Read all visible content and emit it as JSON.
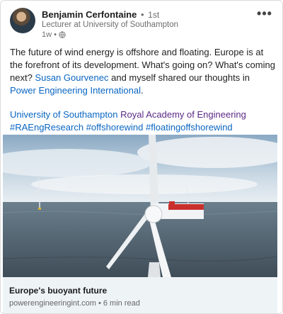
{
  "post": {
    "author": {
      "name": "Benjamin Cerfontaine",
      "separator": "•",
      "degree": "1st",
      "headline": "Lecturer at University of Southampton",
      "time": "1w •"
    },
    "more_label": "•••",
    "body": {
      "p1": "The future of wind energy is offshore and floating. Europe is at the forefront of its development. What's going on? What's coming next? ",
      "mention1": "Susan Gourvenec",
      "p2": " and myself shared our thoughts in ",
      "mention2": "Power Engineering International",
      "p3": "."
    },
    "tags": {
      "org1": "University of Southampton",
      "org2": "Royal Academy of Engineering",
      "hashtag1": "#RAEngResearch",
      "hashtag2": "#offshorewind",
      "hashtag3": "#floatingoffshorewind"
    },
    "link_preview": {
      "title": "Europe's buoyant future",
      "meta": "powerengineeringint.com • 6 min read"
    }
  },
  "icons": {
    "globe": "globe-icon",
    "more": "more-horizontal-icon",
    "avatar": "profile-photo"
  },
  "colors": {
    "link": "#0a66c2",
    "organization": "#5b2a86",
    "preview_background": "#eef3f6"
  }
}
